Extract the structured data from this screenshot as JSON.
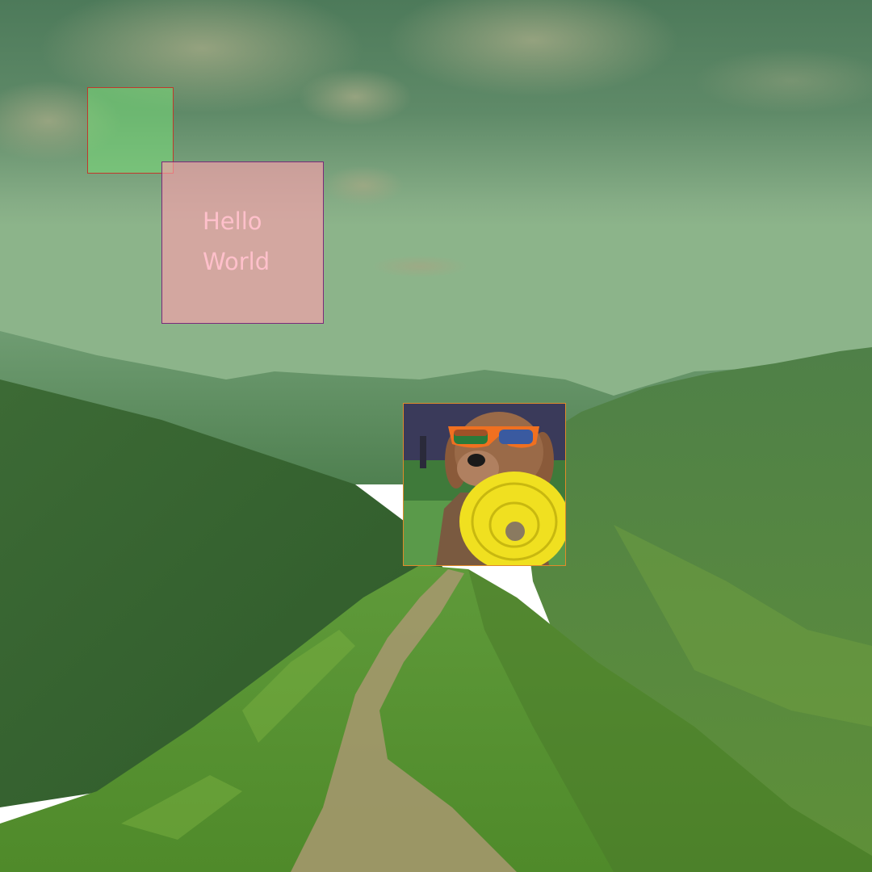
{
  "canvas": {
    "background_description_colors": {
      "sky_top": "#4f7a55",
      "sky_mid": "#6f9a78",
      "haze": "#8fb58e",
      "mountains_far": "#5f8f68",
      "mountains_near": "#3f6f3a",
      "ridge_grass": "#6fa03a",
      "path": "#a89a6a"
    }
  },
  "overlay": {
    "green_square": {
      "fill": "#78dc78",
      "border": "#c0392b"
    },
    "text_box": {
      "fill": "#ffa0af",
      "border": "#7a2a7a",
      "text_color": "#ffc0cb",
      "line1": "Hello",
      "line2": "World"
    },
    "dog_image": {
      "border": "#e08a2a",
      "frisbee_color": "#f0e020",
      "sunglasses_frame": "#f07020"
    }
  }
}
